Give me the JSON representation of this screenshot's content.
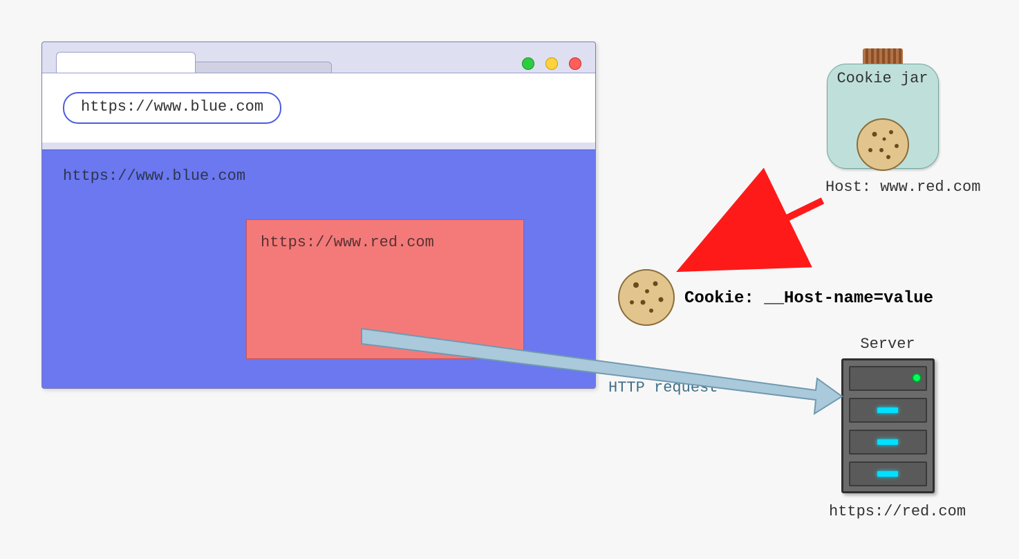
{
  "browser": {
    "address_bar_url": "https://www.blue.com",
    "page_origin_label": "https://www.blue.com",
    "iframe_origin_label": "https://www.red.com"
  },
  "cookie_jar": {
    "label": "Cookie jar",
    "host_label": "Host: www.red.com"
  },
  "cookie_header_text": "Cookie: __Host-name=value",
  "http_request_label": "HTTP request",
  "server": {
    "title": "Server",
    "url_label": "https://red.com"
  }
}
